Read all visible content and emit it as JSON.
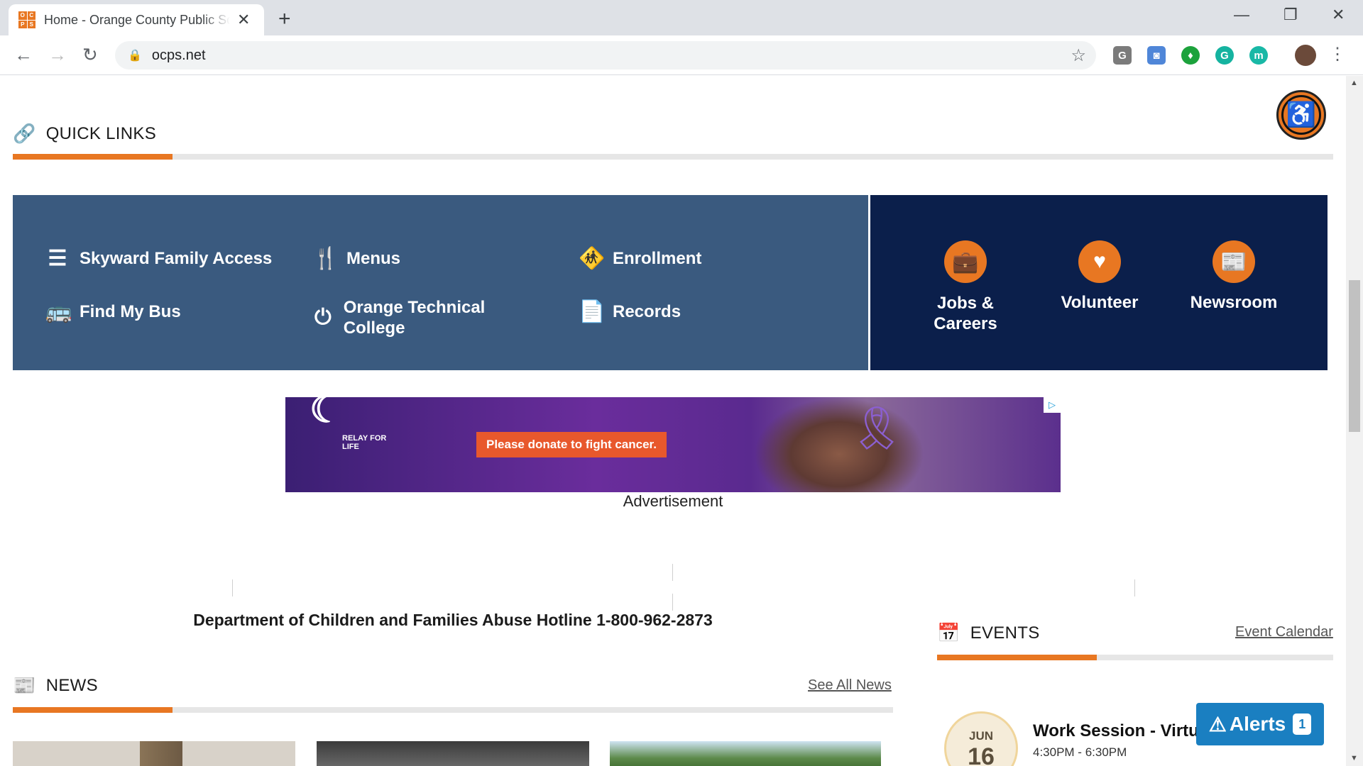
{
  "browser": {
    "tab_title": "Home - Orange County Public Schools",
    "favicon_letters": [
      "O",
      "C",
      "P",
      "S"
    ],
    "url": "ocps.net",
    "extensions": [
      {
        "name": "G",
        "color": "#7b7b7b"
      },
      {
        "name": "camera",
        "color": "#4f86d8"
      },
      {
        "name": "evernote",
        "color": "#1ca23c"
      },
      {
        "name": "grammarly",
        "color": "#15b3a0"
      },
      {
        "name": "m",
        "color": "#19b8a6"
      }
    ]
  },
  "quick_links": {
    "heading": "QUICK LINKS",
    "items": [
      {
        "label": "Skyward Family Access",
        "icon": "list-icon"
      },
      {
        "label": "Menus",
        "icon": "utensils-icon"
      },
      {
        "label": "Enrollment",
        "icon": "child-icon"
      },
      {
        "label": "Find My Bus",
        "icon": "bus-icon"
      },
      {
        "label": "Orange Technical College",
        "icon": "power-icon"
      },
      {
        "label": "Records",
        "icon": "document-icon"
      }
    ],
    "featured": [
      {
        "label": "Jobs & Careers",
        "icon": "briefcase-icon"
      },
      {
        "label": "Volunteer",
        "icon": "heart-icon"
      },
      {
        "label": "Newsroom",
        "icon": "newspaper-icon"
      }
    ]
  },
  "ad": {
    "logo_text": "RELAY FOR LIFE",
    "cta": "Please donate to fight cancer.",
    "label": "Advertisement"
  },
  "hotline": "Department of Children and Families Abuse Hotline 1-800-962-2873",
  "news": {
    "heading": "NEWS",
    "see_all": "See All News"
  },
  "events": {
    "heading": "EVENTS",
    "calendar_link": "Event Calendar",
    "items": [
      {
        "month": "JUN",
        "day": "16",
        "title": "Work Session - Virtual",
        "time": "4:30PM - 6:30PM"
      }
    ]
  },
  "alerts": {
    "label": "Alerts",
    "count": "1"
  }
}
